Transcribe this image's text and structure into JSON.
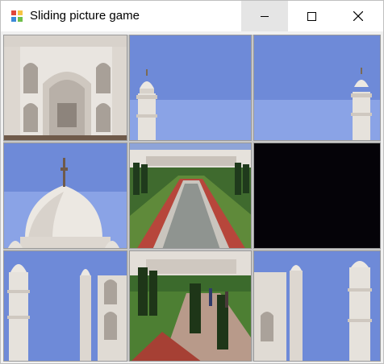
{
  "window": {
    "title": "Sliding picture game"
  },
  "puzzle": {
    "tiles": [
      {
        "slot": 1,
        "content": "taj-facade"
      },
      {
        "slot": 2,
        "content": "minaret-left"
      },
      {
        "slot": 3,
        "content": "minaret-right"
      },
      {
        "slot": 4,
        "content": "dome"
      },
      {
        "slot": 5,
        "content": "reflecting-pool"
      },
      {
        "slot": 6,
        "content": "empty"
      },
      {
        "slot": 7,
        "content": "minaret-and-wing"
      },
      {
        "slot": 8,
        "content": "garden-path"
      },
      {
        "slot": 9,
        "content": "wing-and-minaret"
      }
    ]
  }
}
